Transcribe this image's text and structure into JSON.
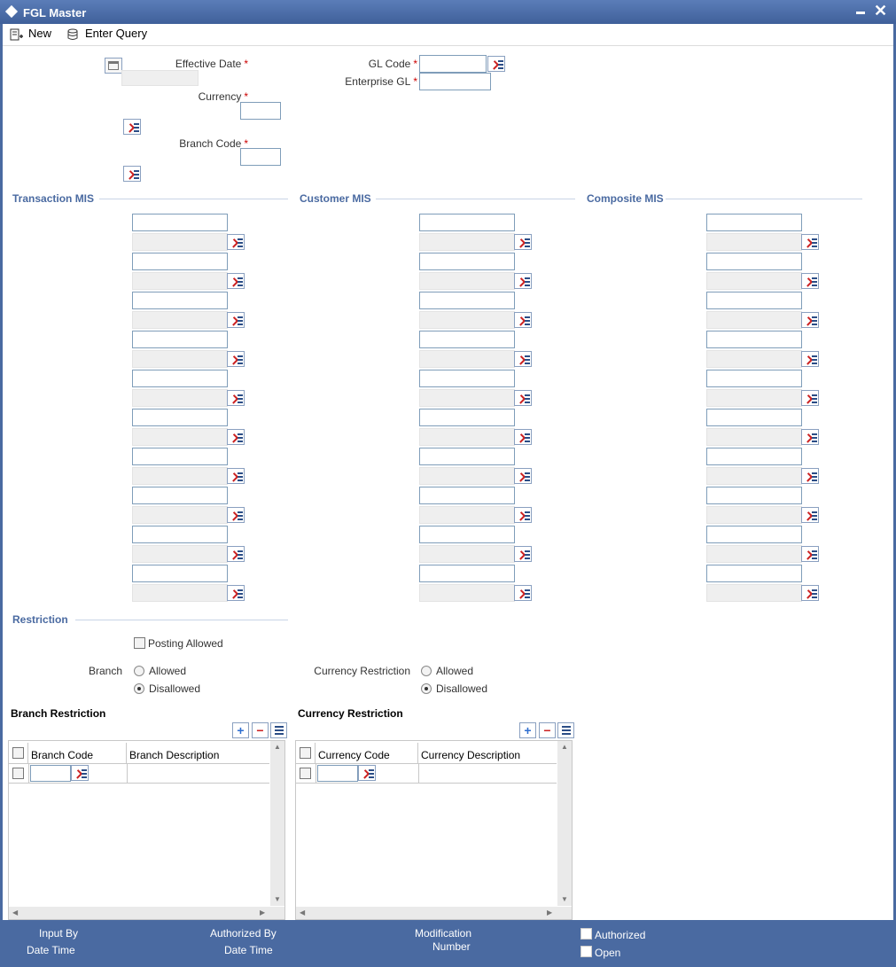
{
  "window": {
    "title": "FGL Master"
  },
  "toolbar": {
    "new_label": "New",
    "enter_query_label": "Enter Query"
  },
  "form": {
    "effective_date_label": "Effective Date",
    "currency_label": "Currency",
    "branch_code_label": "Branch Code",
    "gl_code_label": "GL Code",
    "enterprise_gl_label": "Enterprise GL",
    "required_mark": "*"
  },
  "sections": {
    "transaction_mis": "Transaction MIS",
    "customer_mis": "Customer MIS",
    "composite_mis": "Composite MIS",
    "restriction": "Restriction"
  },
  "restriction": {
    "posting_allowed_label": "Posting Allowed",
    "branch_label": "Branch",
    "currency_restriction_label": "Currency Restriction",
    "allowed_label": "Allowed",
    "disallowed_label": "Disallowed",
    "branch_selected": "Disallowed",
    "currency_selected": "Disallowed"
  },
  "branch_grid": {
    "title": "Branch Restriction",
    "columns": [
      "Branch Code",
      "Branch Description"
    ]
  },
  "currency_grid": {
    "title": "Currency Restriction",
    "columns": [
      "Currency Code",
      "Currency Description"
    ]
  },
  "footer": {
    "input_by": "Input By",
    "date_time_1": "Date Time",
    "authorized_by": "Authorized By",
    "date_time_2": "Date Time",
    "modification": "Modification",
    "number": "Number",
    "authorized": "Authorized",
    "open": "Open"
  }
}
